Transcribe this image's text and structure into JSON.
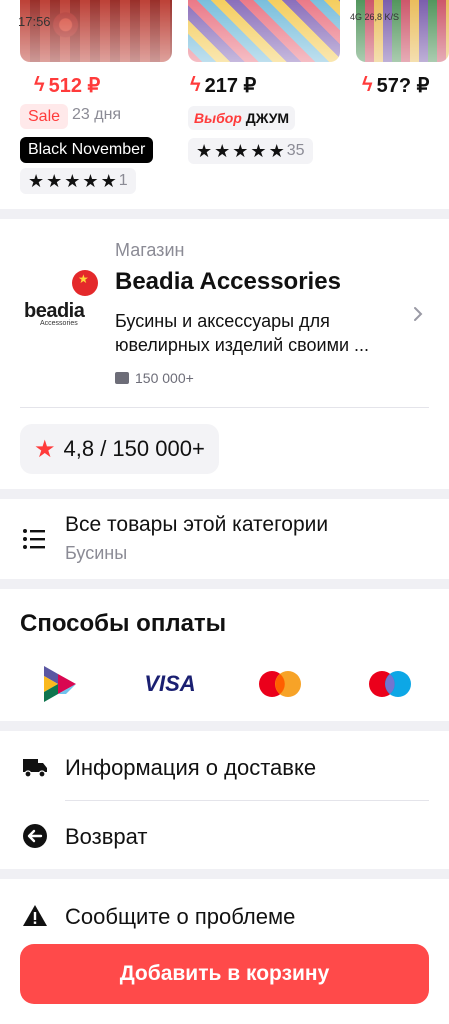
{
  "status_bar": {
    "time": "17:56",
    "right": "4G 26,8 K/S"
  },
  "products": [
    {
      "price": "512 ₽",
      "sale_label": "Sale",
      "days": "23 дня",
      "badge": "Black November",
      "rating_count": "1"
    },
    {
      "price": "217 ₽",
      "vybor": "Выбор",
      "vybor_suffix": "ДЖУМ",
      "rating_count": "35"
    },
    {
      "price": "57? ₽"
    }
  ],
  "store": {
    "label": "Магазин",
    "name": "Beadia Accessories",
    "description": "Бусины и аксессуары для ювелирных изделий своими ...",
    "reviews": "150 000+",
    "logo_text": "beadia",
    "logo_sub": "Accessories"
  },
  "rating": {
    "text": "4,8 / 150 000+"
  },
  "category": {
    "title": "Все товары этой категории",
    "subtitle": "Бусины"
  },
  "payment": {
    "title": "Способы оплаты",
    "visa_label": "VISA"
  },
  "rows": {
    "delivery": "Информация о доставке",
    "return": "Возврат",
    "report": "Сообщите о проблеме"
  },
  "cta": {
    "label": "Добавить в корзину"
  },
  "colors": {
    "accent": "#ff4a4a",
    "muted": "#8b8b95",
    "pill_bg": "#f3f3f6"
  }
}
